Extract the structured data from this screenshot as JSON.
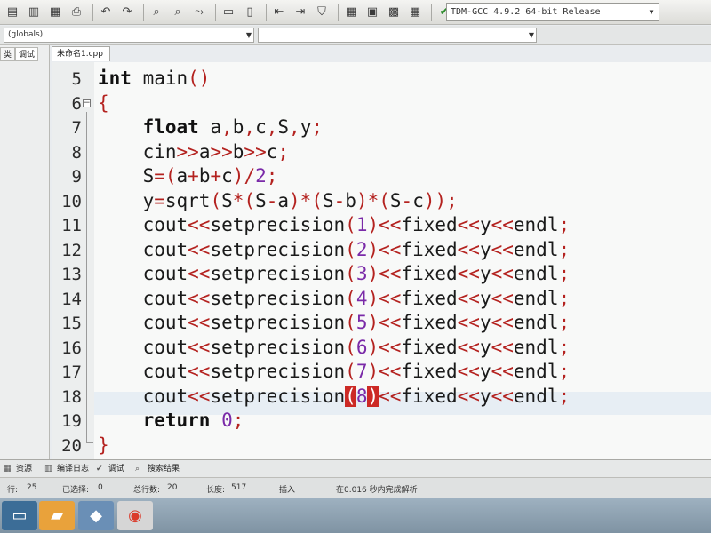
{
  "toolbar": {
    "compiler": "TDM-GCC 4.9.2 64-bit Release"
  },
  "scope": {
    "current": "(globals)",
    "member": ""
  },
  "left_panel": {
    "tabs": [
      "类",
      "调试"
    ]
  },
  "editor": {
    "file_tab": "未命名1.cpp",
    "lines": [
      {
        "n": "5",
        "tokens": [
          {
            "t": "int",
            "c": "kw"
          },
          {
            "t": " main"
          },
          {
            "t": "()",
            "c": "op"
          }
        ]
      },
      {
        "n": "6",
        "tokens": [
          {
            "t": "{",
            "c": "op"
          }
        ]
      },
      {
        "n": "7",
        "tokens": [
          {
            "t": "    "
          },
          {
            "t": "float",
            "c": "kw"
          },
          {
            "t": " a"
          },
          {
            "t": ",",
            "c": "op"
          },
          {
            "t": "b"
          },
          {
            "t": ",",
            "c": "op"
          },
          {
            "t": "c"
          },
          {
            "t": ",",
            "c": "op"
          },
          {
            "t": "S"
          },
          {
            "t": ",",
            "c": "op"
          },
          {
            "t": "y"
          },
          {
            "t": ";",
            "c": "op"
          }
        ]
      },
      {
        "n": "8",
        "tokens": [
          {
            "t": "    cin"
          },
          {
            "t": ">>",
            "c": "op"
          },
          {
            "t": "a"
          },
          {
            "t": ">>",
            "c": "op"
          },
          {
            "t": "b"
          },
          {
            "t": ">>",
            "c": "op"
          },
          {
            "t": "c"
          },
          {
            "t": ";",
            "c": "op"
          }
        ]
      },
      {
        "n": "9",
        "tokens": [
          {
            "t": "    S"
          },
          {
            "t": "=(",
            "c": "op"
          },
          {
            "t": "a"
          },
          {
            "t": "+",
            "c": "op"
          },
          {
            "t": "b"
          },
          {
            "t": "+",
            "c": "op"
          },
          {
            "t": "c"
          },
          {
            "t": ")/",
            "c": "op"
          },
          {
            "t": "2",
            "c": "num"
          },
          {
            "t": ";",
            "c": "op"
          }
        ]
      },
      {
        "n": "10",
        "tokens": [
          {
            "t": "    y"
          },
          {
            "t": "=",
            "c": "op"
          },
          {
            "t": "sqrt"
          },
          {
            "t": "(",
            "c": "op"
          },
          {
            "t": "S"
          },
          {
            "t": "*(",
            "c": "op"
          },
          {
            "t": "S"
          },
          {
            "t": "-",
            "c": "op"
          },
          {
            "t": "a"
          },
          {
            "t": ")*(",
            "c": "op"
          },
          {
            "t": "S"
          },
          {
            "t": "-",
            "c": "op"
          },
          {
            "t": "b"
          },
          {
            "t": ")*(",
            "c": "op"
          },
          {
            "t": "S"
          },
          {
            "t": "-",
            "c": "op"
          },
          {
            "t": "c"
          },
          {
            "t": "));",
            "c": "op"
          }
        ]
      },
      {
        "n": "11",
        "tokens": [
          {
            "t": "    cout"
          },
          {
            "t": "<<",
            "c": "op"
          },
          {
            "t": "setprecision"
          },
          {
            "t": "(",
            "c": "op"
          },
          {
            "t": "1",
            "c": "num"
          },
          {
            "t": ")<<",
            "c": "op"
          },
          {
            "t": "fixed"
          },
          {
            "t": "<<",
            "c": "op"
          },
          {
            "t": "y"
          },
          {
            "t": "<<",
            "c": "op"
          },
          {
            "t": "endl"
          },
          {
            "t": ";",
            "c": "op"
          }
        ]
      },
      {
        "n": "12",
        "tokens": [
          {
            "t": "    cout"
          },
          {
            "t": "<<",
            "c": "op"
          },
          {
            "t": "setprecision"
          },
          {
            "t": "(",
            "c": "op"
          },
          {
            "t": "2",
            "c": "num"
          },
          {
            "t": ")<<",
            "c": "op"
          },
          {
            "t": "fixed"
          },
          {
            "t": "<<",
            "c": "op"
          },
          {
            "t": "y"
          },
          {
            "t": "<<",
            "c": "op"
          },
          {
            "t": "endl"
          },
          {
            "t": ";",
            "c": "op"
          }
        ]
      },
      {
        "n": "13",
        "tokens": [
          {
            "t": "    cout"
          },
          {
            "t": "<<",
            "c": "op"
          },
          {
            "t": "setprecision"
          },
          {
            "t": "(",
            "c": "op"
          },
          {
            "t": "3",
            "c": "num"
          },
          {
            "t": ")<<",
            "c": "op"
          },
          {
            "t": "fixed"
          },
          {
            "t": "<<",
            "c": "op"
          },
          {
            "t": "y"
          },
          {
            "t": "<<",
            "c": "op"
          },
          {
            "t": "endl"
          },
          {
            "t": ";",
            "c": "op"
          }
        ]
      },
      {
        "n": "14",
        "tokens": [
          {
            "t": "    cout"
          },
          {
            "t": "<<",
            "c": "op"
          },
          {
            "t": "setprecision"
          },
          {
            "t": "(",
            "c": "op"
          },
          {
            "t": "4",
            "c": "num"
          },
          {
            "t": ")<<",
            "c": "op"
          },
          {
            "t": "fixed"
          },
          {
            "t": "<<",
            "c": "op"
          },
          {
            "t": "y"
          },
          {
            "t": "<<",
            "c": "op"
          },
          {
            "t": "endl"
          },
          {
            "t": ";",
            "c": "op"
          }
        ]
      },
      {
        "n": "15",
        "tokens": [
          {
            "t": "    cout"
          },
          {
            "t": "<<",
            "c": "op"
          },
          {
            "t": "setprecision"
          },
          {
            "t": "(",
            "c": "op"
          },
          {
            "t": "5",
            "c": "num"
          },
          {
            "t": ")<<",
            "c": "op"
          },
          {
            "t": "fixed"
          },
          {
            "t": "<<",
            "c": "op"
          },
          {
            "t": "y"
          },
          {
            "t": "<<",
            "c": "op"
          },
          {
            "t": "endl"
          },
          {
            "t": ";",
            "c": "op"
          }
        ]
      },
      {
        "n": "16",
        "tokens": [
          {
            "t": "    cout"
          },
          {
            "t": "<<",
            "c": "op"
          },
          {
            "t": "setprecision"
          },
          {
            "t": "(",
            "c": "op"
          },
          {
            "t": "6",
            "c": "num"
          },
          {
            "t": ")<<",
            "c": "op"
          },
          {
            "t": "fixed"
          },
          {
            "t": "<<",
            "c": "op"
          },
          {
            "t": "y"
          },
          {
            "t": "<<",
            "c": "op"
          },
          {
            "t": "endl"
          },
          {
            "t": ";",
            "c": "op"
          }
        ]
      },
      {
        "n": "17",
        "tokens": [
          {
            "t": "    cout"
          },
          {
            "t": "<<",
            "c": "op"
          },
          {
            "t": "setprecision"
          },
          {
            "t": "(",
            "c": "op"
          },
          {
            "t": "7",
            "c": "num"
          },
          {
            "t": ")<<",
            "c": "op"
          },
          {
            "t": "fixed"
          },
          {
            "t": "<<",
            "c": "op"
          },
          {
            "t": "y"
          },
          {
            "t": "<<",
            "c": "op"
          },
          {
            "t": "endl"
          },
          {
            "t": ";",
            "c": "op"
          }
        ]
      },
      {
        "n": "18",
        "tokens": [
          {
            "t": "    cout"
          },
          {
            "t": "<<",
            "c": "op"
          },
          {
            "t": "setprecision"
          },
          {
            "t": "(",
            "c": "brkt"
          },
          {
            "t": "8",
            "c": "num"
          },
          {
            "t": ")",
            "c": "brkt"
          },
          {
            "t": "<<",
            "c": "op"
          },
          {
            "t": "fixed"
          },
          {
            "t": "<<",
            "c": "op"
          },
          {
            "t": "y"
          },
          {
            "t": "<<",
            "c": "op"
          },
          {
            "t": "endl"
          },
          {
            "t": ";",
            "c": "op"
          }
        ]
      },
      {
        "n": "19",
        "tokens": [
          {
            "t": "    "
          },
          {
            "t": "return",
            "c": "kw"
          },
          {
            "t": " "
          },
          {
            "t": "0",
            "c": "num"
          },
          {
            "t": ";",
            "c": "op"
          }
        ]
      },
      {
        "n": "20",
        "tokens": [
          {
            "t": "}",
            "c": "op"
          }
        ]
      }
    ]
  },
  "bottom_tabs": [
    "资源",
    "编译日志",
    "调试",
    "搜索结果"
  ],
  "status": {
    "row_label": "行:",
    "row": "25",
    "selected_label": "已选择:",
    "selected": "0",
    "total_label": "总行数:",
    "total": "20",
    "length_label": "长度:",
    "length": "517",
    "mode": "插入",
    "message": "在0.016 秒内完成解析"
  },
  "colors": {
    "keyword": "#111111",
    "operator": "#b4221f",
    "number": "#7a2aa8",
    "bracket_match": "#cc2a25"
  }
}
